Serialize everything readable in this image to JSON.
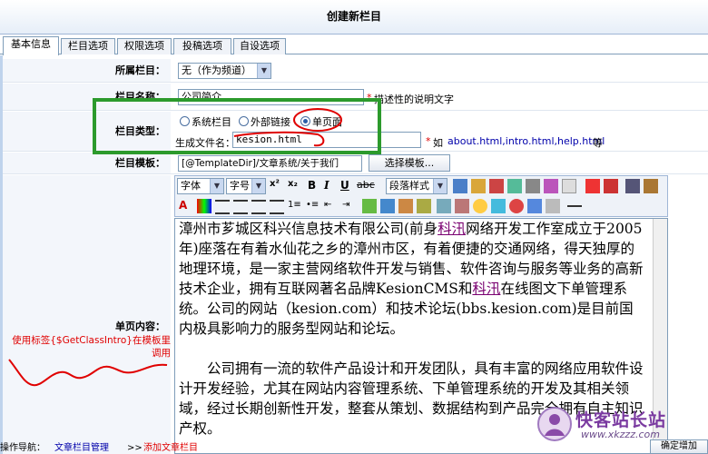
{
  "window": {
    "title": "创建新栏目"
  },
  "tabs": [
    {
      "label": "基本信息"
    },
    {
      "label": "栏目选项"
    },
    {
      "label": "权限选项"
    },
    {
      "label": "投稿选项"
    },
    {
      "label": "自设选项"
    }
  ],
  "form": {
    "parent": {
      "label": "所属栏目：",
      "value": "无（作为频道）"
    },
    "name": {
      "label": "栏目名称：",
      "value": "公司简介",
      "star": "*",
      "hint": "描述性的说明文字"
    },
    "type": {
      "label": "栏目类型：",
      "options": [
        "系统栏目",
        "外部链接",
        "单页面"
      ],
      "selected": 2,
      "filename_label": "生成文件名：",
      "filename_value": "kesion.html",
      "star": "*",
      "hint_prefix": "如",
      "hint_examples": "about.html,intro.html,help.html",
      "hint_suffix": "等"
    },
    "template": {
      "label": "栏目模板：",
      "value": "[@TemplateDir]/文章系统/关于我们",
      "button": "选择模板..."
    },
    "content": {
      "label": "单页内容：",
      "tip": "使用标签{$GetClassIntro}在模板里调用"
    }
  },
  "editor": {
    "font_select": "字体",
    "size_select": "字号",
    "style_select": "段落样式",
    "paragraph1_a": "漳州市芗城区科兴信息技术有限公司(前身",
    "paragraph1_link": "科汛",
    "paragraph1_b": "网络开发工作室成立于2005年)座落在有着水仙花之乡的漳州市区，有着便捷的交通网络，得天独厚的地理环境，是一家主营网络软件开发与销售、软件咨询与服务等业务的高新技术企业，拥有互联网著名品牌KesionCMS和",
    "paragraph1_link2": "科汛",
    "paragraph1_c": "在线图文下单管理系统。公司的网站（kesion.com）和技术论坛(bbs.kesion.com)是目前国内极具影响力的服务型网站和论坛。",
    "paragraph2": "公司拥有一流的软件产品设计和开发团队，具有丰富的网络应用软件设计开发经验，尤其在网站内容管理系统、下单管理系统的开发及其相关领域，经过长期创新性开发，整套从策划、数据结构到产品完全拥有自主知识产权。"
  },
  "footer": {
    "nav_label": "操作导航：",
    "crumb1": "文章栏目管理",
    "sep": ">>",
    "crumb2": "添加文章栏目",
    "action": "确定增加"
  },
  "watermark": {
    "text": "快客站长站",
    "url": "www.xkzzz.com"
  },
  "colors": {
    "accent": "#2c9a2c",
    "annotation_red": "#e00000",
    "link_purple": "#7a0070",
    "link_blue": "#00a"
  }
}
